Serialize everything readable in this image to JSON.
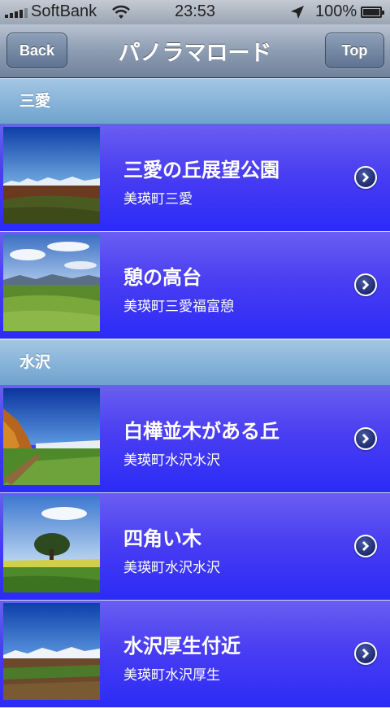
{
  "status_bar": {
    "carrier": "SoftBank",
    "time": "23:53",
    "battery": "100%"
  },
  "nav": {
    "title": "パノラマロード",
    "back_label": "Back",
    "top_label": "Top"
  },
  "sections": [
    {
      "header": "三愛",
      "items": [
        {
          "title": "三愛の丘展望公園",
          "subtitle": "美瑛町三愛"
        },
        {
          "title": "憩の高台",
          "subtitle": "美瑛町三愛福富憩"
        }
      ]
    },
    {
      "header": "水沢",
      "items": [
        {
          "title": "白樺並木がある丘",
          "subtitle": "美瑛町水沢水沢"
        },
        {
          "title": "四角い木",
          "subtitle": "美瑛町水沢水沢"
        },
        {
          "title": "水沢厚生付近",
          "subtitle": "美瑛町水沢厚生"
        }
      ]
    }
  ],
  "icons": [
    "signal-icon",
    "wifi-icon",
    "location-arrow-icon",
    "battery-icon",
    "chevron-right-icon"
  ]
}
